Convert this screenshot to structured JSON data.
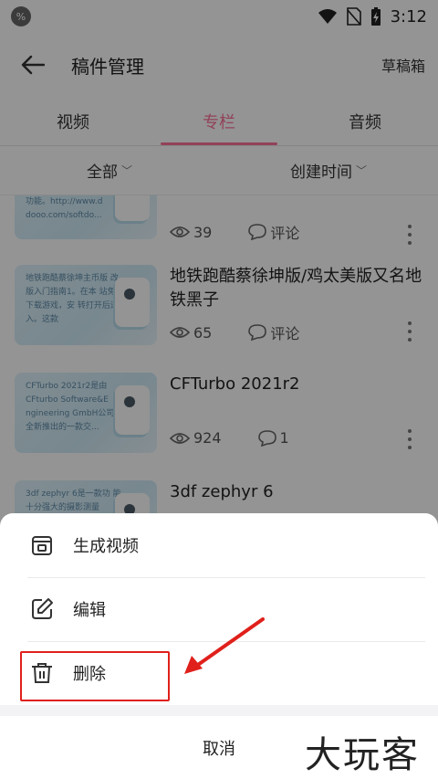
{
  "status_bar": {
    "app_badge": "%",
    "time": "3:12"
  },
  "header": {
    "title": "稿件管理",
    "drafts_label": "草稿箱"
  },
  "tabs": [
    {
      "label": "视频",
      "active": false
    },
    {
      "label": "专栏",
      "active": true
    },
    {
      "label": "音频",
      "active": false
    }
  ],
  "filters": {
    "category": "全部",
    "sort": "创建时间"
  },
  "articles": [
    {
      "title": "",
      "thumb_text": "功能。http://www.d dooo.com/softdo...",
      "views": "39",
      "comments": "评论"
    },
    {
      "title": "地铁跑酷蔡徐坤版/鸡太美版又名地铁黑子",
      "thumb_text": "地铁跑酷蔡徐坤主币版 改版入门指南1。在本 站免费下载游戏，安 转打开后进入。这款",
      "views": "65",
      "comments": "评论"
    },
    {
      "title": "CFTurbo 2021r2",
      "thumb_text": "CFTurbo 2021r2是由 CFturbo Software&E ngineering GmbH公司 全新推出的一款交...",
      "views": "924",
      "comments": "1"
    },
    {
      "title": "3df zephyr 6",
      "thumb_text": "3df zephyr 6是一款功 能十分强大的摄影测量",
      "views": "",
      "comments": ""
    }
  ],
  "action_sheet": {
    "items": [
      {
        "label": "生成视频",
        "icon": "video-generate-icon"
      },
      {
        "label": "编辑",
        "icon": "edit-icon"
      },
      {
        "label": "删除",
        "icon": "trash-icon"
      }
    ],
    "cancel_label": "取消"
  },
  "annotation": {
    "highlight_color": "#e0201b"
  },
  "watermark": "大玩客",
  "colors": {
    "accent": "#fb7299",
    "overlay": "rgba(0,0,0,0.42)"
  }
}
